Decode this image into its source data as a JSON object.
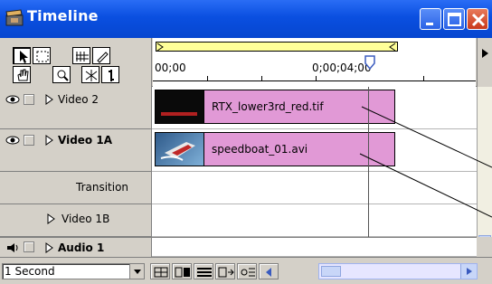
{
  "window": {
    "title": "Timeline",
    "title_icon": "clapperboard-icon",
    "controls": [
      "minimize-icon",
      "maximize-icon",
      "close-icon"
    ]
  },
  "tools": [
    {
      "name": "selection-tool-icon",
      "selected": true
    },
    {
      "name": "range-select-tool-icon",
      "selected": false
    },
    {
      "name": "track-select-tool-icon",
      "selected": false
    },
    {
      "name": "pen-tool-icon",
      "selected": false
    },
    {
      "name": "hand-tool-icon",
      "selected": false
    },
    {
      "name": "zoom-tool-icon",
      "selected": false
    },
    {
      "name": "razor-tool-icon",
      "selected": false
    },
    {
      "name": "in-out-tool-icon",
      "selected": false
    }
  ],
  "ruler": {
    "start_timecode": "00;00",
    "marker_timecode": "0;00;04;00"
  },
  "tracks": [
    {
      "name": "Video 2",
      "bold": false,
      "eye": true,
      "expand": true,
      "clip": {
        "label": "RTX_lower3rd_red.tif",
        "thumb": "title-thumbnail"
      }
    },
    {
      "name": "Video 1A",
      "bold": true,
      "eye": true,
      "expand": true,
      "clip": {
        "label": "speedboat_01.avi",
        "thumb": "speedboat-thumbnail"
      }
    },
    {
      "name": "Transition",
      "bold": false,
      "eye": false,
      "expand": false
    },
    {
      "name": "Video 1B",
      "bold": false,
      "eye": false,
      "expand": true
    },
    {
      "name": "Audio 1",
      "bold": true,
      "speaker": true,
      "expand": true
    }
  ],
  "status": {
    "zoom_level": "1 Second"
  },
  "colors": {
    "clip": "#e199d6",
    "title_bar": "#0a4fe0",
    "work_area": "#ffff99"
  }
}
